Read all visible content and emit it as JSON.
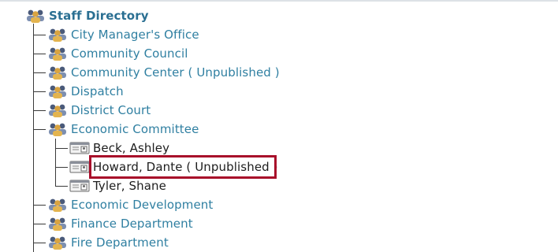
{
  "tree": {
    "root_label": "Staff Directory",
    "departments_top": [
      {
        "label": "City Manager's Office"
      },
      {
        "label": "Community Council"
      },
      {
        "label": "Community Center ( Unpublished )"
      },
      {
        "label": "Dispatch"
      },
      {
        "label": "District Court"
      },
      {
        "label": "Economic Committee"
      }
    ],
    "economic_committee_people": [
      {
        "label": "Beck, Ashley"
      },
      {
        "label": "Howard, Dante ( Unpublished )"
      },
      {
        "label": "Tyler, Shane"
      }
    ],
    "departments_bottom": [
      {
        "label": "Economic Development"
      },
      {
        "label": "Finance Department"
      },
      {
        "label": "Fire Department"
      }
    ]
  },
  "icons": {
    "group": "people-group-icon",
    "person": "contact-card-icon"
  },
  "colors": {
    "link": "#2f7fa1",
    "root": "#2a6f92",
    "text": "#1d1d1d",
    "highlight": "#a80e2a",
    "tree_line": "#3a3a3a"
  }
}
